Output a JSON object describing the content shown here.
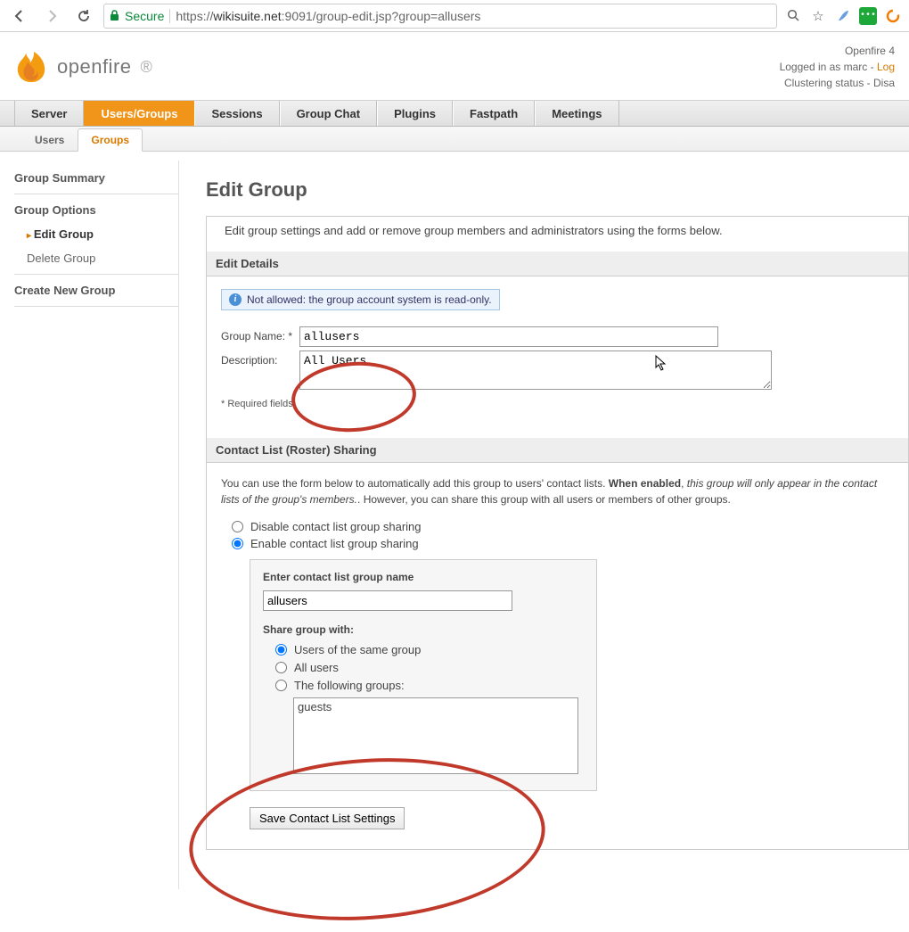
{
  "browser": {
    "secure_label": "Secure",
    "url_prefix": "https://",
    "url_host": "wikisuite.net",
    "url_port": ":9091",
    "url_path": "/group-edit.jsp?group=allusers"
  },
  "header": {
    "product": "openfire",
    "status_line1": "Openfire 4",
    "status_line2_prefix": "Logged in as marc - ",
    "status_line2_link": "Log",
    "status_line3": "Clustering status - Disa"
  },
  "main_nav": [
    "Server",
    "Users/Groups",
    "Sessions",
    "Group Chat",
    "Plugins",
    "Fastpath",
    "Meetings"
  ],
  "sub_nav": [
    "Users",
    "Groups"
  ],
  "sidebar": {
    "summary": "Group Summary",
    "options": "Group Options",
    "edit": "Edit Group",
    "delete": "Delete Group",
    "create": "Create New Group"
  },
  "page": {
    "title": "Edit Group",
    "intro": "Edit group settings and add or remove group members and administrators using the forms below."
  },
  "details": {
    "header": "Edit Details",
    "notice": "Not allowed: the group account system is read-only.",
    "name_label": "Group Name: *",
    "name_value": "allusers",
    "desc_label": "Description:",
    "desc_value": "All Users",
    "required": "* Required fields"
  },
  "sharing": {
    "header": "Contact List (Roster) Sharing",
    "desc_pre": "You can use the form below to automatically add this group to users' contact lists. ",
    "desc_bold": "When enabled",
    "desc_mid": ", ",
    "desc_ital": "this group will only appear in the contact lists of the group's members.",
    "desc_post": ". However, you can share this group with all users or members of other groups.",
    "opt_disable": "Disable contact list group sharing",
    "opt_enable": "Enable contact list group sharing",
    "enter_label": "Enter contact list group name",
    "enter_value": "allusers",
    "share_with_label": "Share group with:",
    "share_same": "Users of the same group",
    "share_all": "All users",
    "share_following": "The following groups:",
    "group_option": "guests",
    "save_btn": "Save Contact List Settings"
  }
}
